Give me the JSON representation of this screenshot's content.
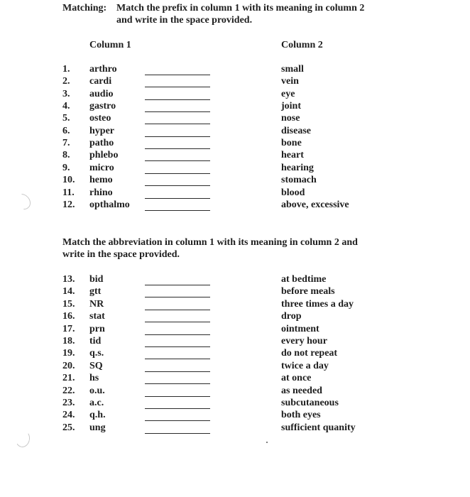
{
  "section1": {
    "label": "Matching:",
    "instruction_line1": "Match the prefix in column 1 with its meaning in column 2",
    "instruction_line2": "and write in the space provided.",
    "column1_header": "Column 1",
    "column2_header": "Column 2",
    "items": [
      {
        "number": "1.",
        "term": "arthro",
        "meaning": "small"
      },
      {
        "number": "2.",
        "term": "cardi",
        "meaning": "vein"
      },
      {
        "number": "3.",
        "term": "audio",
        "meaning": "eye"
      },
      {
        "number": "4.",
        "term": "gastro",
        "meaning": "joint"
      },
      {
        "number": "5.",
        "term": "osteo",
        "meaning": "nose"
      },
      {
        "number": "6.",
        "term": "hyper",
        "meaning": "disease"
      },
      {
        "number": "7.",
        "term": "patho",
        "meaning": "bone"
      },
      {
        "number": "8.",
        "term": "phlebo",
        "meaning": "heart"
      },
      {
        "number": "9.",
        "term": "micro",
        "meaning": "hearing"
      },
      {
        "number": "10.",
        "term": "hemo",
        "meaning": "stomach"
      },
      {
        "number": "11.",
        "term": "rhino",
        "meaning": "blood"
      },
      {
        "number": "12.",
        "term": "opthalmo",
        "meaning": "above, excessive"
      }
    ]
  },
  "section2": {
    "instruction_line1": "Match the abbreviation in column 1 with its meaning in column 2 and",
    "instruction_line2": "write in the space provided.",
    "items": [
      {
        "number": "13.",
        "term": "bid",
        "meaning": "at bedtime"
      },
      {
        "number": "14.",
        "term": "gtt",
        "meaning": "before meals"
      },
      {
        "number": "15.",
        "term": "NR",
        "meaning": "three times a day"
      },
      {
        "number": "16.",
        "term": "stat",
        "meaning": "drop"
      },
      {
        "number": "17.",
        "term": "prn",
        "meaning": "ointment"
      },
      {
        "number": "18.",
        "term": "tid",
        "meaning": "every hour"
      },
      {
        "number": "19.",
        "term": "q.s.",
        "meaning": "do not repeat"
      },
      {
        "number": "20.",
        "term": "SQ",
        "meaning": "twice a day"
      },
      {
        "number": "21.",
        "term": "hs",
        "meaning": "at once"
      },
      {
        "number": "22.",
        "term": "o.u.",
        "meaning": "as needed"
      },
      {
        "number": "23.",
        "term": "a.c.",
        "meaning": "subcutaneous"
      },
      {
        "number": "24.",
        "term": "q.h.",
        "meaning": "both eyes"
      },
      {
        "number": "25.",
        "term": "ung",
        "meaning": "sufficient quanity"
      }
    ]
  }
}
